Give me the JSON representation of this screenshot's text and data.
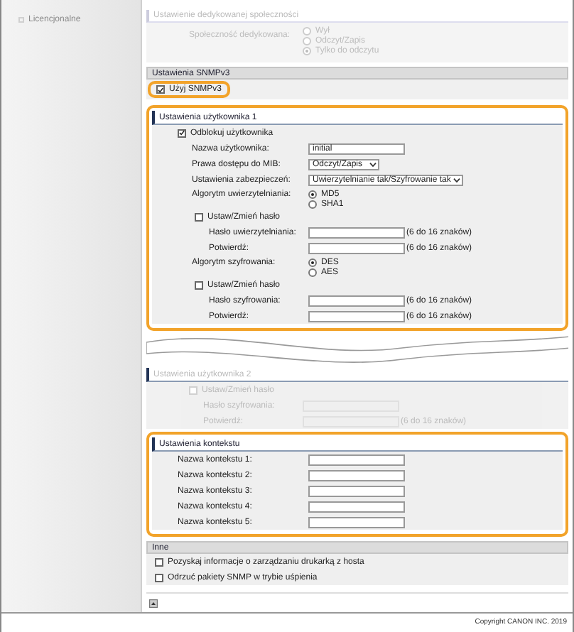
{
  "sidebar": {
    "items": [
      {
        "label": "Licencjonalne"
      }
    ]
  },
  "community": {
    "title": "Ustawienie dedykowanej społeczności",
    "disabled": true,
    "label": "Społeczność dedykowana:",
    "options": [
      {
        "label": "Wył",
        "selected": false
      },
      {
        "label": "Odczyt/Zapis",
        "selected": false
      },
      {
        "label": "Tylko do odczytu",
        "selected": true
      }
    ]
  },
  "snmpv3": {
    "title": "Ustawienia SNMPv3",
    "highlighted": true,
    "use": {
      "label": "Użyj SNMPv3",
      "checked": true
    }
  },
  "user1": {
    "title": "Ustawienia użytkownika 1",
    "highlighted": true,
    "rows": [
      {
        "kind": "checkbox",
        "label": "Odblokuj użytkownika",
        "checked": true,
        "children": [
          {
            "kind": "text",
            "label": "Nazwa użytkownika:",
            "value": "initial"
          },
          {
            "kind": "select",
            "label": "Prawa dostępu do MIB:",
            "value": "Odczyt/Zapis"
          },
          {
            "kind": "select",
            "label": "Ustawienia zabezpieczeń:",
            "value": "Uwierzytelnianie tak/Szyfrowanie tak"
          },
          {
            "kind": "radio",
            "label": "Algorytm uwierzytelniania:",
            "options": [
              {
                "label": "MD5",
                "selected": true
              },
              {
                "label": "SHA1",
                "selected": false
              }
            ]
          },
          {
            "kind": "checkbox",
            "label": "Ustaw/Zmień hasło",
            "checked": false,
            "children": [
              {
                "kind": "password",
                "label": "Hasło uwierzytelniania:",
                "hint": "(6 do 16 znaków)"
              },
              {
                "kind": "password",
                "label": "Potwierdź:",
                "hint": "(6 do 16 znaków)"
              }
            ]
          },
          {
            "kind": "radio",
            "label": "Algorytm szyfrowania:",
            "options": [
              {
                "label": "DES",
                "selected": true
              },
              {
                "label": "AES",
                "selected": false
              }
            ]
          },
          {
            "kind": "checkbox",
            "label": "Ustaw/Zmień hasło",
            "checked": false,
            "children": [
              {
                "kind": "password",
                "label": "Hasło szyfrowania:",
                "hint": "(6 do 16 znaków)"
              },
              {
                "kind": "password",
                "label": "Potwierdź:",
                "hint": "(6 do 16 znaków)"
              }
            ]
          }
        ]
      }
    ]
  },
  "user2": {
    "title": "Ustawienia użytkownika 2",
    "disabled": true,
    "rows": [
      {
        "kind": "checkbox",
        "label": "Ustaw/Zmień hasło",
        "checked": false,
        "children": [
          {
            "kind": "password",
            "label": "Hasło szyfrowania:"
          },
          {
            "kind": "password",
            "label": "Potwierdź:",
            "hint": "(6 do 16 znaków)"
          }
        ]
      }
    ]
  },
  "context": {
    "title": "Ustawienia kontekstu",
    "highlighted": true,
    "rows": [
      {
        "kind": "text",
        "label": "Nazwa kontekstu 1:"
      },
      {
        "kind": "text",
        "label": "Nazwa kontekstu 2:"
      },
      {
        "kind": "text",
        "label": "Nazwa kontekstu 3:"
      },
      {
        "kind": "text",
        "label": "Nazwa kontekstu 4:"
      },
      {
        "kind": "text",
        "label": "Nazwa kontekstu 5:"
      }
    ]
  },
  "other": {
    "title": "Inne",
    "options": [
      {
        "label": "Pozyskaj informacje o zarządzaniu drukarką z hosta",
        "checked": false
      },
      {
        "label": "Odrzuć pakiety SNMP w trybie uśpienia",
        "checked": false
      }
    ]
  },
  "footer": {
    "copyright": "Copyright CANON INC. 2019"
  }
}
